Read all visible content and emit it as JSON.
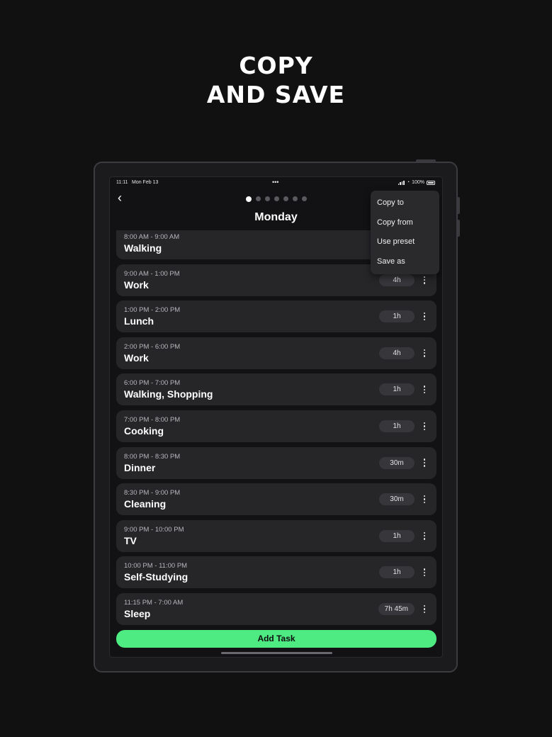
{
  "headline": {
    "line1": "COPY",
    "line2": "AND SAVE"
  },
  "status_bar": {
    "time": "11:11",
    "date": "Mon Feb 13",
    "more": "•••",
    "battery": "100%"
  },
  "header": {
    "title": "Monday",
    "back_icon": "chevron-left-icon",
    "pages_total": 7,
    "active_page": 1
  },
  "menu": {
    "items": [
      "Copy to",
      "Copy from",
      "Use preset",
      "Save as"
    ]
  },
  "tasks": [
    {
      "time": "8:00 AM - 9:00 AM",
      "name": "Walking",
      "duration": ""
    },
    {
      "time": "9:00 AM - 1:00 PM",
      "name": "Work",
      "duration": "4h"
    },
    {
      "time": "1:00 PM - 2:00 PM",
      "name": "Lunch",
      "duration": "1h"
    },
    {
      "time": "2:00 PM - 6:00 PM",
      "name": "Work",
      "duration": "4h"
    },
    {
      "time": "6:00 PM - 7:00 PM",
      "name": "Walking, Shopping",
      "duration": "1h"
    },
    {
      "time": "7:00 PM - 8:00 PM",
      "name": "Cooking",
      "duration": "1h"
    },
    {
      "time": "8:00 PM - 8:30 PM",
      "name": "Dinner",
      "duration": "30m"
    },
    {
      "time": "8:30 PM - 9:00 PM",
      "name": "Cleaning",
      "duration": "30m"
    },
    {
      "time": "9:00 PM - 10:00 PM",
      "name": "TV",
      "duration": "1h"
    },
    {
      "time": "10:00 PM - 11:00 PM",
      "name": "Self-Studying",
      "duration": "1h"
    },
    {
      "time": "11:15 PM - 7:00 AM",
      "name": "Sleep",
      "duration": "7h 45m"
    }
  ],
  "add_button": {
    "label": "Add Task"
  },
  "colors": {
    "accent": "#4eea82",
    "background": "#111112",
    "card": "#262629"
  }
}
